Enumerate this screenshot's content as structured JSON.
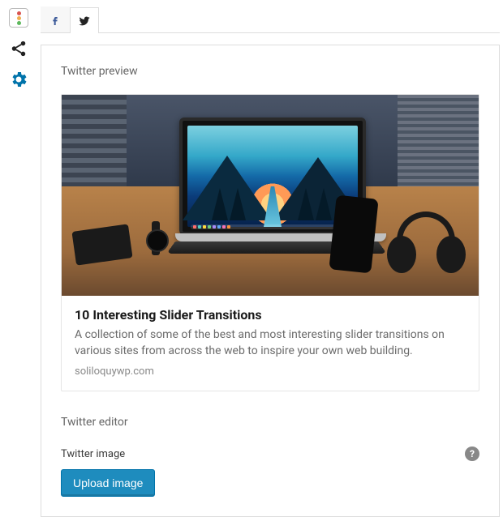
{
  "rail": {
    "traffic_icon": "traffic-light-icon",
    "share_icon": "share-icon",
    "settings_icon": "gear-icon"
  },
  "tabs": {
    "facebook": {
      "label": "Facebook",
      "icon": "facebook-icon"
    },
    "twitter": {
      "label": "Twitter",
      "icon": "twitter-icon",
      "active": true
    }
  },
  "preview": {
    "section_label": "Twitter preview",
    "title": "10 Interesting Slider Transitions",
    "description": "A collection of some of the best and most interesting slider transitions on various sites from across the web to inspire your own web building.",
    "domain": "soliloquywp.com"
  },
  "editor": {
    "section_label": "Twitter editor",
    "image_field_label": "Twitter image",
    "upload_button": "Upload image",
    "help_glyph": "?"
  },
  "colors": {
    "accent": "#1e8cbe",
    "gear": "#0073aa",
    "facebook": "#3b5998",
    "twitter": "#222"
  }
}
